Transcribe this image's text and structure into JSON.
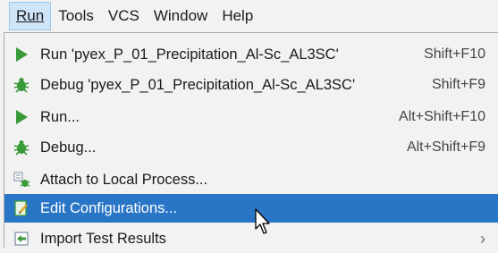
{
  "menubar": {
    "items": [
      {
        "label": "Run"
      },
      {
        "label": "Tools"
      },
      {
        "label": "VCS"
      },
      {
        "label": "Window"
      },
      {
        "label": "Help"
      }
    ]
  },
  "run_menu": {
    "items": [
      {
        "label": "Run 'pyex_P_01_Precipitation_Al-Sc_AL3SC'",
        "shortcut": "Shift+F10",
        "icon": "run-icon"
      },
      {
        "label": "Debug 'pyex_P_01_Precipitation_Al-Sc_AL3SC'",
        "shortcut": "Shift+F9",
        "icon": "debug-icon"
      },
      {
        "label": "Run...",
        "shortcut": "Alt+Shift+F10",
        "icon": "run-icon"
      },
      {
        "label": "Debug...",
        "shortcut": "Alt+Shift+F9",
        "icon": "debug-icon"
      },
      {
        "label": "Attach to Local Process...",
        "shortcut": "",
        "icon": "attach-process-icon"
      },
      {
        "label": "Edit Configurations...",
        "shortcut": "",
        "icon": "edit-config-icon"
      },
      {
        "label": "Import Test Results",
        "shortcut": "",
        "icon": "import-icon"
      }
    ]
  },
  "colors": {
    "selection": "#2a76c6",
    "run_green": "#3a9a3a",
    "menu_bg": "#f2f2f2"
  }
}
